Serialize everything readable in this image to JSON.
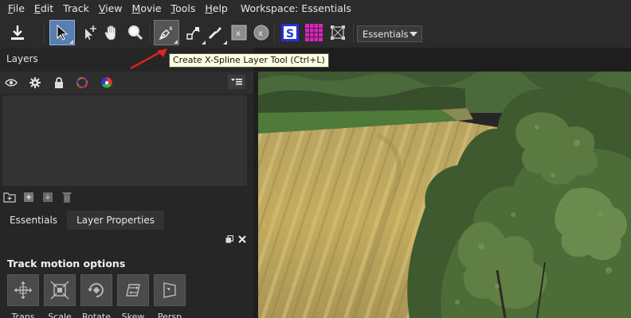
{
  "menu": {
    "items": [
      {
        "label": "File",
        "ul": "F",
        "rest": "ile"
      },
      {
        "label": "Edit",
        "ul": "E",
        "rest": "dit"
      },
      {
        "label": "Track",
        "ul": "",
        "rest": "Track"
      },
      {
        "label": "View",
        "ul": "V",
        "rest": "iew"
      },
      {
        "label": "Movie",
        "ul": "M",
        "rest": "ovie"
      },
      {
        "label": "Tools",
        "ul": "T",
        "rest": "ools"
      },
      {
        "label": "Help",
        "ul": "H",
        "rest": "elp"
      }
    ],
    "workspace_label": "Workspace: Essentials"
  },
  "toolbar": {
    "workspace_value": "Essentials",
    "tooltip": "Create X-Spline Layer Tool (Ctrl+L)"
  },
  "layers": {
    "title": "Layers"
  },
  "tabs": [
    {
      "label": "Essentials"
    },
    {
      "label": "Layer Properties"
    }
  ],
  "track_motion": {
    "title": "Track motion options",
    "buttons": [
      {
        "label": "Trans"
      },
      {
        "label": "Scale"
      },
      {
        "label": "Rotate"
      },
      {
        "label": "Skew"
      },
      {
        "label": "Persp"
      }
    ]
  },
  "colors": {
    "accent": "#5a7fae",
    "tooltip_bg": "#ffffe1",
    "arrow": "#e8221e",
    "s_button": "#2233dd",
    "grid_button": "#e020c0"
  }
}
